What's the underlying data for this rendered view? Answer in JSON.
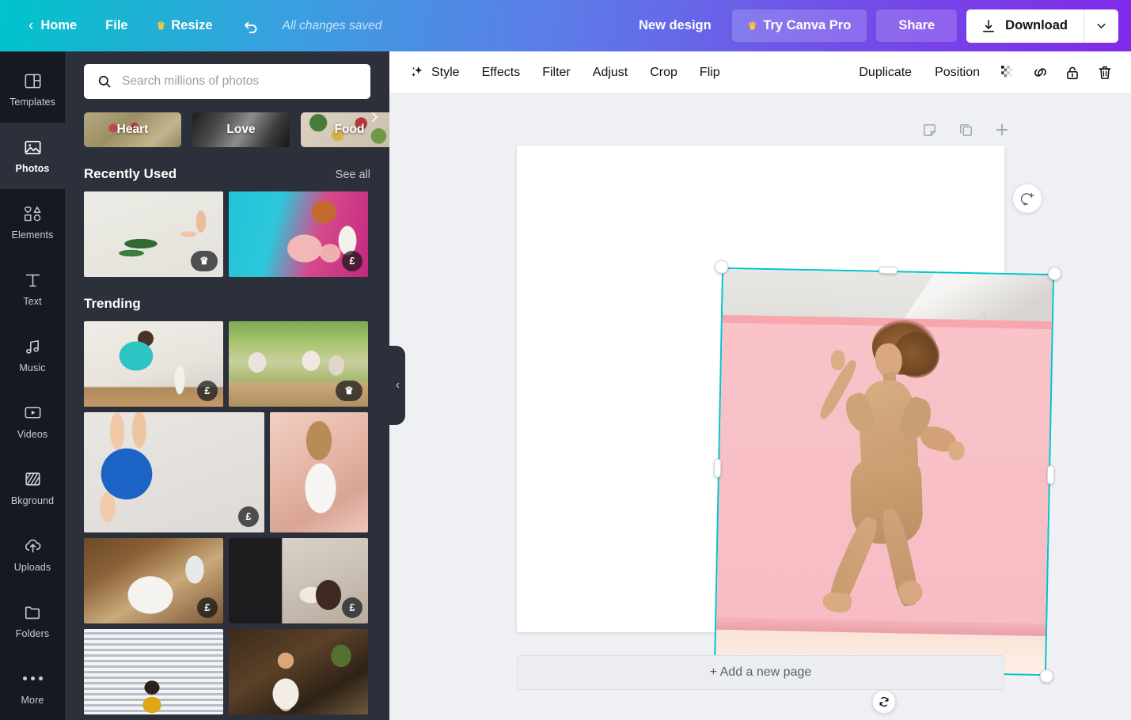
{
  "topbar": {
    "home_label": "Home",
    "file_label": "File",
    "resize_label": "Resize",
    "undo_icon": "undo-arrow-icon",
    "save_status": "All changes saved",
    "new_design_label": "New design",
    "try_pro_label": "Try Canva Pro",
    "pro_crown_icon": "crown-icon",
    "share_label": "Share",
    "download_label": "Download",
    "download_icon": "download-arrow-icon",
    "download_caret_icon": "chevron-down-icon",
    "gradient_start": "#00c4cc",
    "gradient_end": "#8129e8"
  },
  "rail": {
    "items": [
      {
        "label": "Templates",
        "icon": "templates-icon",
        "active": false
      },
      {
        "label": "Photos",
        "icon": "photos-icon",
        "active": true
      },
      {
        "label": "Elements",
        "icon": "elements-icon",
        "active": false
      },
      {
        "label": "Text",
        "icon": "text-icon",
        "active": false
      },
      {
        "label": "Music",
        "icon": "music-icon",
        "active": false
      },
      {
        "label": "Videos",
        "icon": "videos-icon",
        "active": false
      },
      {
        "label": "Bkground",
        "icon": "background-icon",
        "active": false
      },
      {
        "label": "Uploads",
        "icon": "uploads-icon",
        "active": false
      },
      {
        "label": "Folders",
        "icon": "folders-icon",
        "active": false
      },
      {
        "label": "More",
        "icon": "more-dots-icon",
        "active": false
      }
    ]
  },
  "panel": {
    "search": {
      "value": "",
      "placeholder": "Search millions of photos",
      "icon": "search-icon"
    },
    "chips": [
      {
        "label": "Heart"
      },
      {
        "label": "Love"
      },
      {
        "label": "Food"
      }
    ],
    "chips_next_icon": "chevron-right-icon",
    "recently_used": {
      "title": "Recently Used",
      "see_all": "See all",
      "items": [
        {
          "name": "hand-holding-palm-leaf",
          "badge": "crown"
        },
        {
          "name": "woman-with-pink-roses",
          "badge": "£"
        }
      ]
    },
    "trending": {
      "title": "Trending",
      "items": [
        {
          "name": "man-cooking-in-kitchen",
          "badge": "£"
        },
        {
          "name": "friends-toasting-outdoor-table",
          "badge": "crown"
        },
        {
          "name": "hands-holding-globe",
          "badge": "£"
        },
        {
          "name": "woman-in-white-shirt-pink-wall",
          "badge": ""
        },
        {
          "name": "washing-greens-in-sink",
          "badge": "£"
        },
        {
          "name": "woman-by-wood-stove",
          "badge": "£"
        },
        {
          "name": "person-by-window-blinds",
          "badge": ""
        },
        {
          "name": "bearded-shop-owner",
          "badge": ""
        }
      ]
    },
    "collapse_icon": "chevron-left-icon"
  },
  "context_toolbar": {
    "left_items": [
      {
        "label": "Style",
        "icon": "sparkle-icon"
      },
      {
        "label": "Effects",
        "icon": ""
      },
      {
        "label": "Filter",
        "icon": ""
      },
      {
        "label": "Adjust",
        "icon": ""
      },
      {
        "label": "Crop",
        "icon": ""
      },
      {
        "label": "Flip",
        "icon": ""
      }
    ],
    "right_items": [
      {
        "label": "Duplicate",
        "type": "text"
      },
      {
        "label": "Position",
        "type": "text"
      }
    ],
    "right_icons": [
      {
        "name": "transparency-icon"
      },
      {
        "name": "link-icon"
      },
      {
        "name": "unlock-icon"
      },
      {
        "name": "trash-icon"
      }
    ]
  },
  "page_tools": [
    {
      "name": "notes-icon"
    },
    {
      "name": "duplicate-page-icon"
    },
    {
      "name": "add-page-icon"
    }
  ],
  "canvas": {
    "selected_element": "dancing-woman-pink-backdrop-photo",
    "selection_color": "#00c4cc",
    "rotation_icon": "rotate-icon",
    "comment_icon": "add-comment-icon",
    "add_page_label": "+ Add a new page"
  }
}
